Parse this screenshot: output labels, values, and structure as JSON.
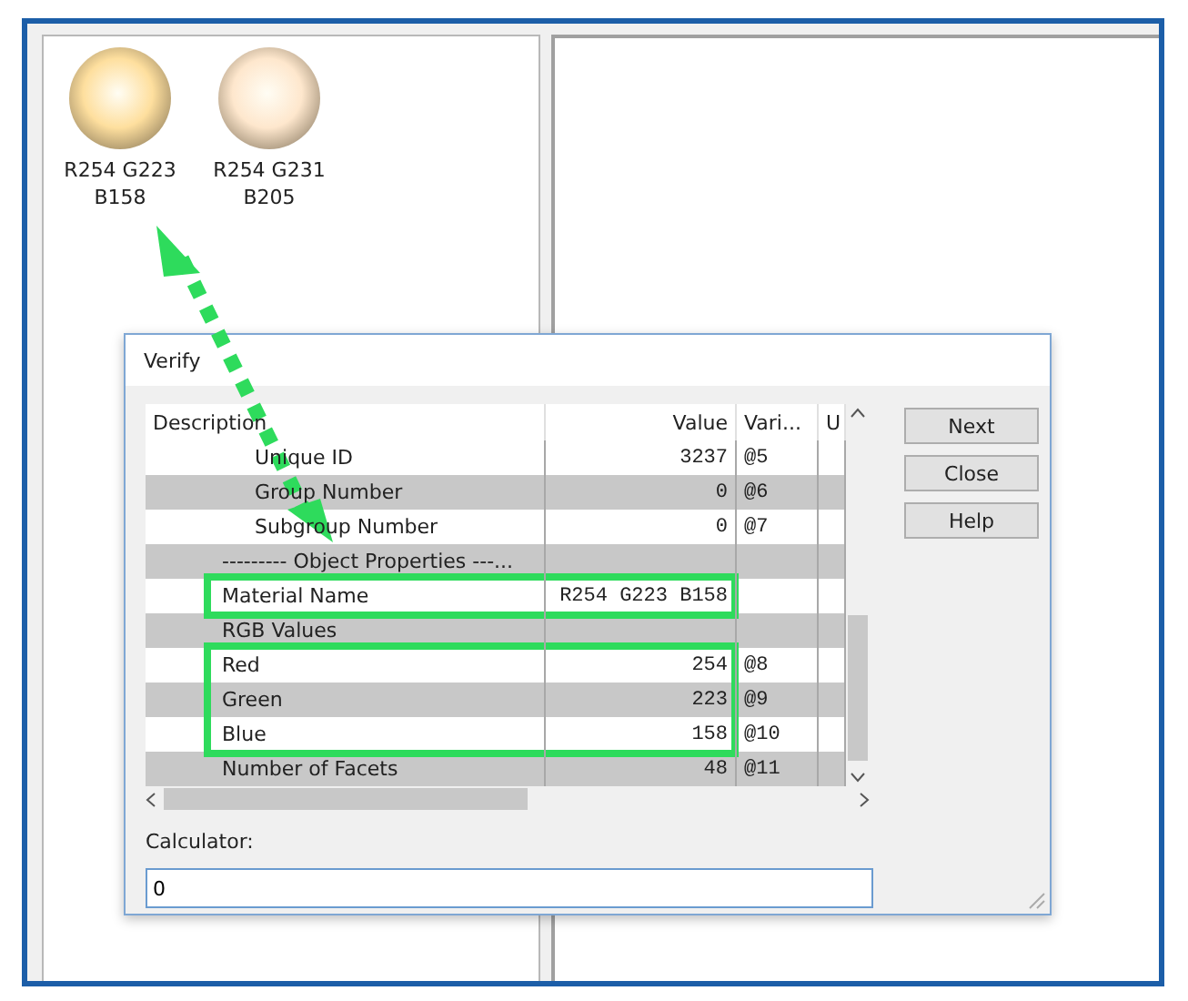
{
  "swatches": [
    {
      "label": "R254 G223 B158",
      "color": "#fedf9e"
    },
    {
      "label": "R254 G231 B205",
      "color": "#fee7cd"
    }
  ],
  "dialog": {
    "title": "Verify",
    "table": {
      "columns": [
        "Description",
        "Value",
        "Vari...",
        "U"
      ],
      "rows": [
        {
          "children": [
            {
              "label": "Unique ID",
              "value": "3237",
              "variable": "@5",
              "highlighted": false
            },
            {
              "label": "Group Number",
              "value": "0",
              "variable": "@6",
              "highlighted": false
            },
            {
              "label": "Subgroup Number",
              "value": "0",
              "variable": "@7",
              "highlighted": false
            }
          ]
        },
        {
          "label": "--------- Object Properties ---...",
          "highlighted": false
        },
        {
          "label": "Material Name",
          "value": "R254  G223  B158",
          "highlighted": true
        },
        {
          "label": "RGB Values",
          "highlighted": false
        },
        {
          "label": "Red",
          "value": "254",
          "variable": "@8",
          "highlighted": true
        },
        {
          "label": "Green",
          "value": "223",
          "variable": "@9",
          "highlighted": true
        },
        {
          "label": "Blue",
          "value": "158",
          "variable": "@10",
          "highlighted": true
        },
        {
          "label": "Number of Facets",
          "value": "48",
          "variable": "@11",
          "highlighted": false
        }
      ]
    },
    "buttons": [
      "Next",
      "Close",
      "Help"
    ],
    "calculator": {
      "label": "Calculator:",
      "value": "0"
    }
  }
}
